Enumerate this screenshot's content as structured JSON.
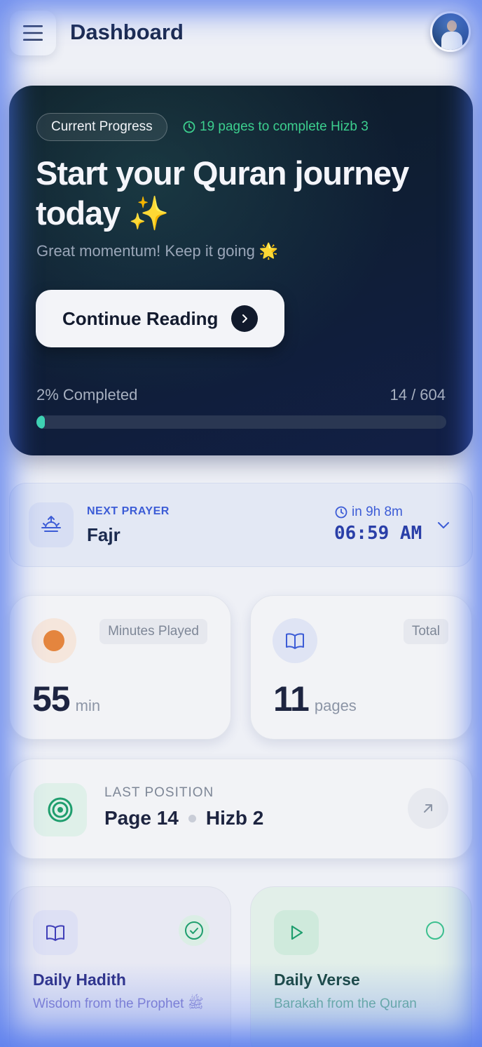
{
  "header": {
    "title": "Dashboard",
    "menu_icon": "hamburger-menu-icon",
    "avatar_icon": "user-avatar"
  },
  "hero": {
    "badge": "Current Progress",
    "pages_left": "19 pages to complete Hizb 3",
    "title": "Start your Quran journey today ✨",
    "subtitle": "Great momentum! Keep it going 🌟",
    "cta_label": "Continue Reading",
    "progress_label": "2% Completed",
    "progress_count": "14 / 604",
    "progress_fraction": 0.02,
    "accent_color": "#3fd3b3"
  },
  "prayer": {
    "label": "NEXT PRAYER",
    "name": "Fajr",
    "countdown": "in 9h 8m",
    "time": "06:59 AM"
  },
  "stats": {
    "minutes": {
      "tag": "Minutes Played",
      "value": "55",
      "unit": "min"
    },
    "pages": {
      "tag": "Total",
      "value": "11",
      "unit": "pages"
    }
  },
  "last_position": {
    "label": "LAST POSITION",
    "page": "Page 14",
    "hizb": "Hizb 2"
  },
  "daily": {
    "hadith": {
      "title": "Daily Hadith",
      "subtitle": "Wisdom from the Prophet ﷺ",
      "done": true
    },
    "verse": {
      "title": "Daily Verse",
      "subtitle": "Barakah from the Quran",
      "done": false
    }
  }
}
